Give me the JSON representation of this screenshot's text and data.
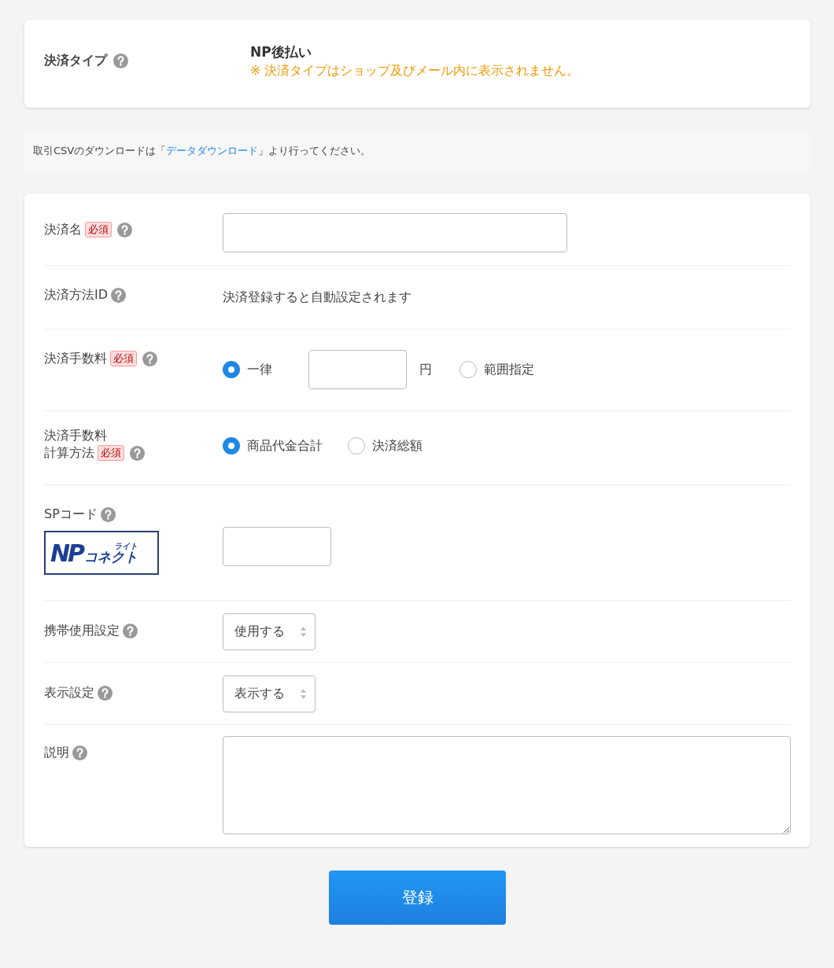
{
  "payment_type": {
    "label": "決済タイプ",
    "value": "NP後払い",
    "note": "※ 決済タイプはショップ及びメール内に表示されません。"
  },
  "info": {
    "before": "取引CSVのダウンロードは「",
    "link": "データダウンロード",
    "after": "」より行ってください。"
  },
  "form": {
    "rows": [
      {
        "kind": "input",
        "label": [
          "決済名"
        ],
        "required": "必須"
      },
      {
        "kind": "text",
        "label": [
          "決済方法ID"
        ],
        "value": "決済登録すると自動設定されます"
      },
      {
        "kind": "fee",
        "label": [
          "決済手数料"
        ],
        "required": "必須",
        "options": [
          {
            "label": "一律",
            "selected": true
          },
          {
            "label": "範囲指定",
            "selected": false
          }
        ],
        "unit": "円"
      },
      {
        "kind": "radios",
        "label": [
          "決済手数料",
          "計算方法"
        ],
        "required": "必須",
        "options": [
          {
            "label": "商品代金合計",
            "selected": true
          },
          {
            "label": "決済総額",
            "selected": false
          }
        ]
      },
      {
        "kind": "spcode",
        "label": [
          "SPコード"
        ],
        "logo": {
          "mark": "NP",
          "sub": "ライト",
          "name": "コネクト"
        }
      },
      {
        "kind": "select",
        "label": [
          "携帯使用設定"
        ],
        "value": "使用する"
      },
      {
        "kind": "select",
        "label": [
          "表示設定"
        ],
        "value": "表示する"
      },
      {
        "kind": "textarea",
        "label": [
          "説明"
        ]
      }
    ]
  },
  "submit": "登録"
}
